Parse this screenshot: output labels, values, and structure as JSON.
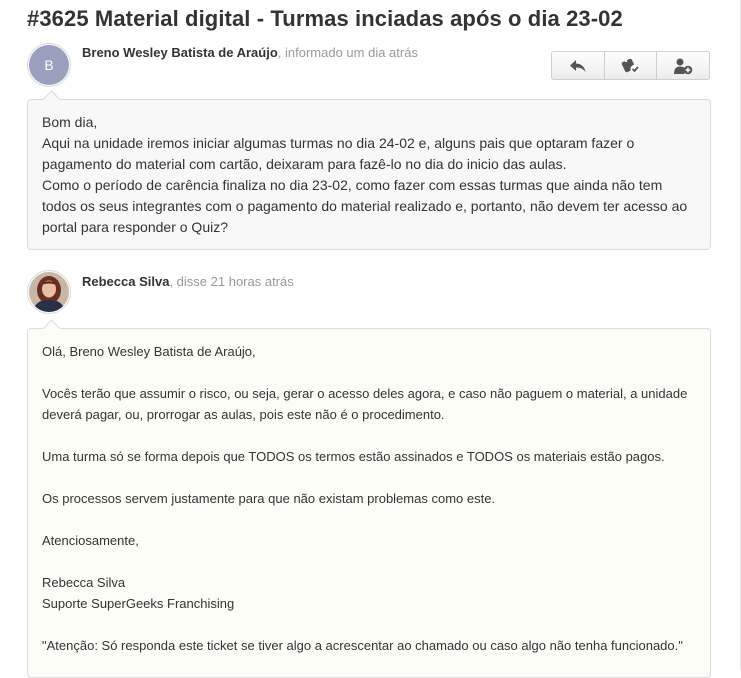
{
  "ticket": {
    "title": "#3625 Material digital - Turmas inciadas após o dia 23-02"
  },
  "toolbar": {
    "buttons": [
      {
        "name": "reply-icon"
      },
      {
        "name": "resolve-ticket-icon"
      },
      {
        "name": "add-follower-icon"
      }
    ]
  },
  "messages": [
    {
      "avatar_letter": "B",
      "avatar_color": "#9aa1bf",
      "author": "Breno Wesley Batista de Araújo",
      "time": ", informado um dia atrás",
      "lines": [
        "Bom dia,",
        "Aqui na unidade iremos iniciar algumas turmas no dia 24-02 e, alguns pais que optaram fazer o",
        "pagamento do material com cartão, deixaram para fazê-lo no dia do inicio das aulas.",
        "Como o período de carência finaliza no dia 23-02, como fazer com essas turmas que ainda não tem",
        "todos os seus integrantes com o pagamento do material realizado e, portanto, não devem ter acesso ao",
        "portal para responder o Quiz?"
      ]
    },
    {
      "author": "Rebecca Silva",
      "time": ", disse 21 horas atrás",
      "greeting": "Olá, Breno Wesley Batista de Araújo,",
      "p1_line1": "Vocês terão que assumir o risco, ou seja, gerar o acesso deles agora, e caso não paguem o material, a unidade",
      "p1_line2": "deverá pagar, ou, prorrogar as aulas, pois este não é o procedimento.",
      "p2": "Uma turma só se forma depois que TODOS os termos estão assinados e TODOS os materiais estão pagos.",
      "p3": "Os processos servem justamente para que não existam problemas como este.",
      "closing": "Atenciosamente,",
      "sig_name": "Rebecca Silva",
      "sig_team": "Suporte SuperGeeks Franchising",
      "notice": "\"Atenção: Só responda este ticket se tiver algo a acrescentar ao chamado ou caso algo não tenha funcionado.\""
    }
  ]
}
